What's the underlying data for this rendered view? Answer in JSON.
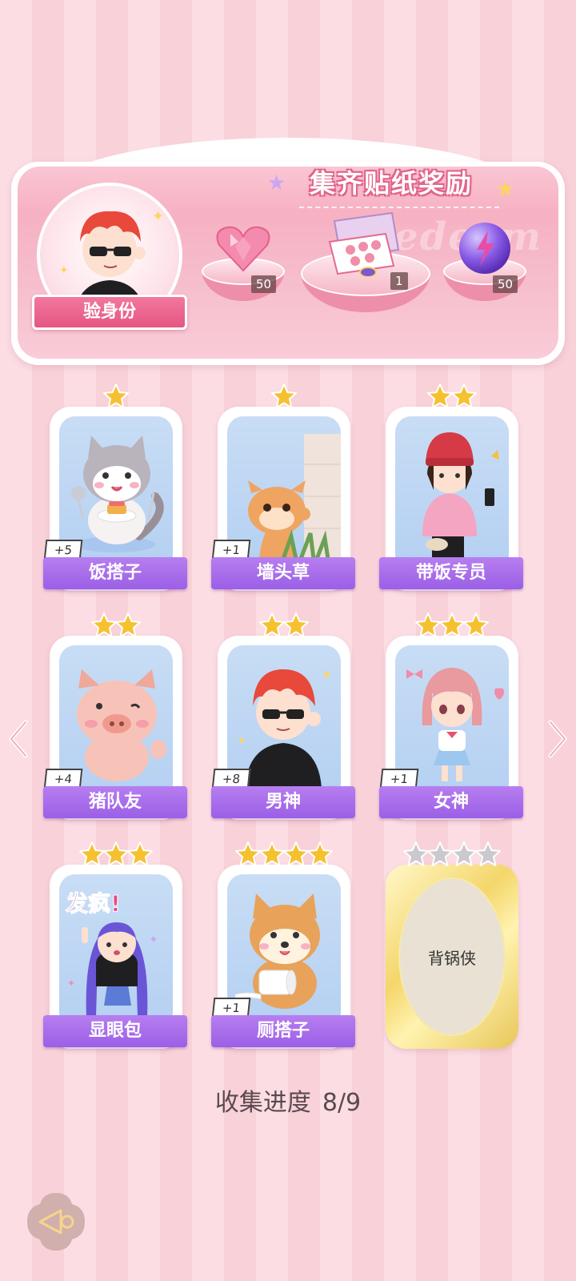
{
  "banner": {
    "title": "集齐贴纸奖励",
    "watermark": "Redeem",
    "verify_label": "验身份",
    "rewards": [
      {
        "name": "pink-heart-gem",
        "count": "50"
      },
      {
        "name": "gift-pack",
        "count": "1"
      },
      {
        "name": "purple-lightning-orb",
        "count": "50"
      }
    ]
  },
  "stickers": [
    {
      "name": "饭搭子",
      "stars": 1,
      "dup": "+5",
      "collected": true,
      "art": "cat"
    },
    {
      "name": "墙头草",
      "stars": 1,
      "dup": "+1",
      "collected": true,
      "art": "squirrel"
    },
    {
      "name": "带饭专员",
      "stars": 2,
      "dup": "",
      "collected": true,
      "art": "girl-hat"
    },
    {
      "name": "猪队友",
      "stars": 2,
      "dup": "+4",
      "collected": true,
      "art": "pig"
    },
    {
      "name": "男神",
      "stars": 2,
      "dup": "+8",
      "collected": true,
      "art": "boy"
    },
    {
      "name": "女神",
      "stars": 3,
      "dup": "+1",
      "collected": true,
      "art": "girl-pink"
    },
    {
      "name": "显眼包",
      "stars": 3,
      "dup": "",
      "collected": true,
      "art": "girl-purple",
      "art_text": "发疯!"
    },
    {
      "name": "厕搭子",
      "stars": 4,
      "dup": "+1",
      "collected": true,
      "art": "shiba"
    },
    {
      "name": "背锅侠",
      "stars": 4,
      "dup": "",
      "collected": false,
      "art": "locked"
    }
  ],
  "progress": {
    "label": "收集进度",
    "value": "8/9"
  },
  "colors": {
    "accent_pink": "#e55683",
    "label_purple": "#9b5fe6",
    "star_gold": "#f6c12f",
    "star_gray": "#c9c9cf"
  }
}
